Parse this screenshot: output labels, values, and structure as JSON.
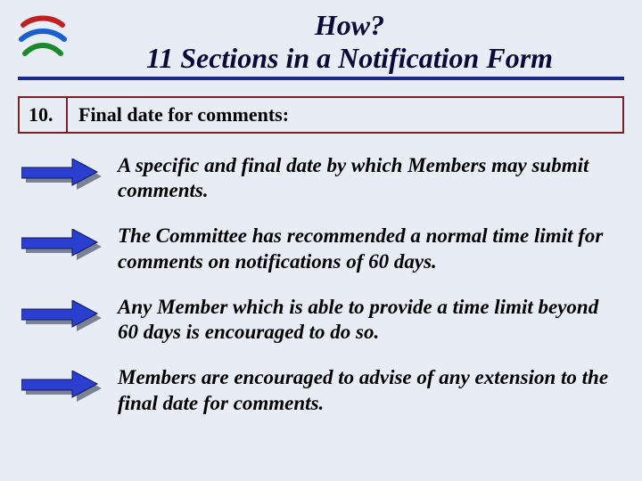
{
  "title_line1": "How?",
  "title_line2": "11 Sections in a Notification Form",
  "section": {
    "number": "10.",
    "label": "Final date for comments:"
  },
  "bullets": [
    "A specific and final date by which Members may submit comments.",
    "The Committee has recommended a normal time limit for comments on notifications of 60 days.",
    "Any Member which is able to provide a time limit beyond 60 days is encouraged to do so.",
    "Members are encouraged to advise of any extension to the final date for comments."
  ],
  "colors": {
    "accent_underline": "#1a2a8a",
    "box_border": "#7a2020",
    "arrow_fill": "#2a3fd0",
    "arrow_shadow": "#7b8293"
  }
}
